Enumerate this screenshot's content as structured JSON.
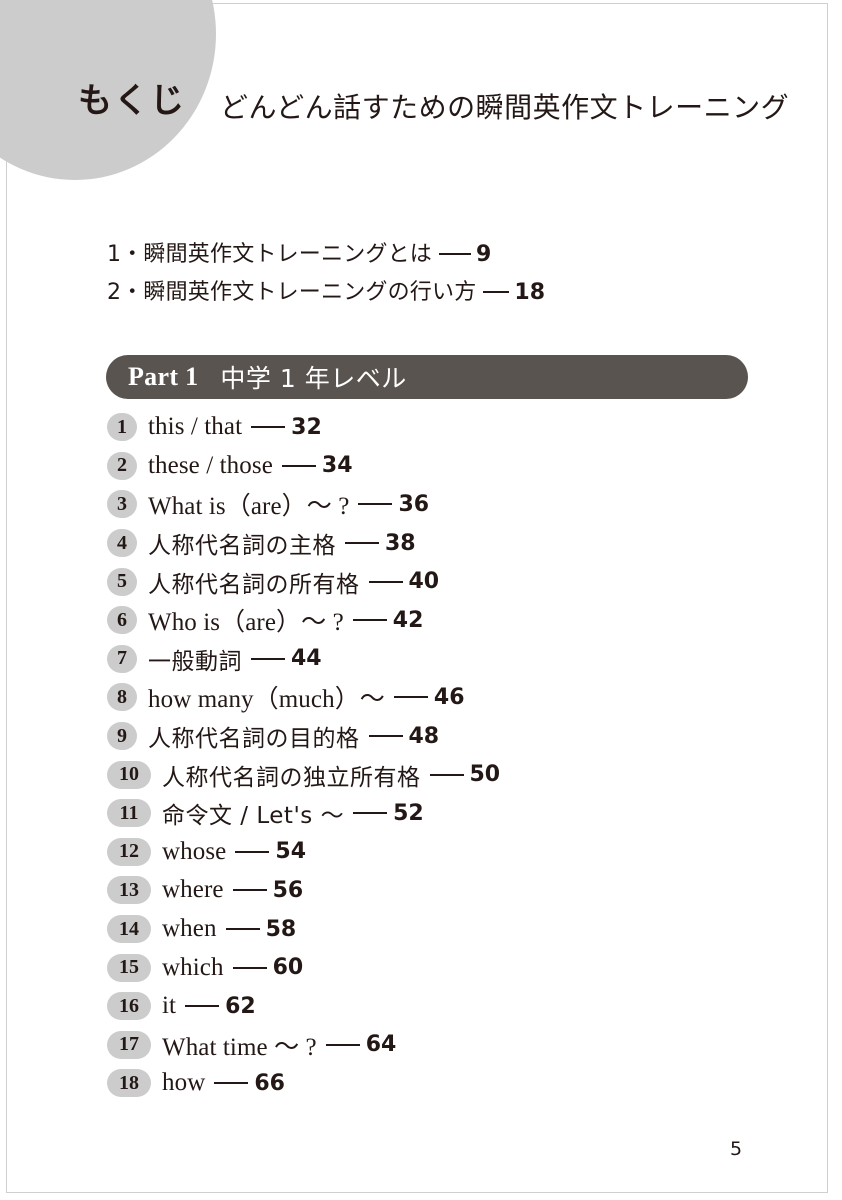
{
  "header": {
    "blob_label": "もくじ",
    "subtitle": "どんどん話すための瞬間英作文トレーニング",
    "blob_color": "#cccccc"
  },
  "intro": {
    "items": [
      {
        "label": "1・瞬間英作文トレーニングとは",
        "page": "9"
      },
      {
        "label": "2・瞬間英作文トレーニングの行い方",
        "page": "18"
      }
    ]
  },
  "part_banner": {
    "name": "Part 1",
    "description": "中学 1 年レベル",
    "background": "#595450",
    "text_color": "#ffffff"
  },
  "toc": {
    "badge_color": "#cccccc",
    "items": [
      {
        "num": "1",
        "title": "this / that",
        "page": "32",
        "script": "en"
      },
      {
        "num": "2",
        "title": "these / those",
        "page": "34",
        "script": "en"
      },
      {
        "num": "3",
        "title": "What is（are）〜 ?",
        "page": "36",
        "script": "en"
      },
      {
        "num": "4",
        "title": "人称代名詞の主格",
        "page": "38",
        "script": "jp"
      },
      {
        "num": "5",
        "title": "人称代名詞の所有格",
        "page": "40",
        "script": "jp"
      },
      {
        "num": "6",
        "title": "Who is（are）〜 ?",
        "page": "42",
        "script": "en"
      },
      {
        "num": "7",
        "title": "一般動詞",
        "page": "44",
        "script": "jp"
      },
      {
        "num": "8",
        "title": "how many（much）〜",
        "page": "46",
        "script": "en"
      },
      {
        "num": "9",
        "title": "人称代名詞の目的格",
        "page": "48",
        "script": "jp"
      },
      {
        "num": "10",
        "title": "人称代名詞の独立所有格",
        "page": "50",
        "script": "jp"
      },
      {
        "num": "11",
        "title": "命令文 / Let's 〜",
        "page": "52",
        "script": "jp"
      },
      {
        "num": "12",
        "title": "whose",
        "page": "54",
        "script": "en"
      },
      {
        "num": "13",
        "title": "where",
        "page": "56",
        "script": "en"
      },
      {
        "num": "14",
        "title": "when",
        "page": "58",
        "script": "en"
      },
      {
        "num": "15",
        "title": "which",
        "page": "60",
        "script": "en"
      },
      {
        "num": "16",
        "title": "it",
        "page": "62",
        "script": "en"
      },
      {
        "num": "17",
        "title": "What time 〜 ?",
        "page": "64",
        "script": "en"
      },
      {
        "num": "18",
        "title": "how",
        "page": "66",
        "script": "en"
      }
    ]
  },
  "folio": "5"
}
